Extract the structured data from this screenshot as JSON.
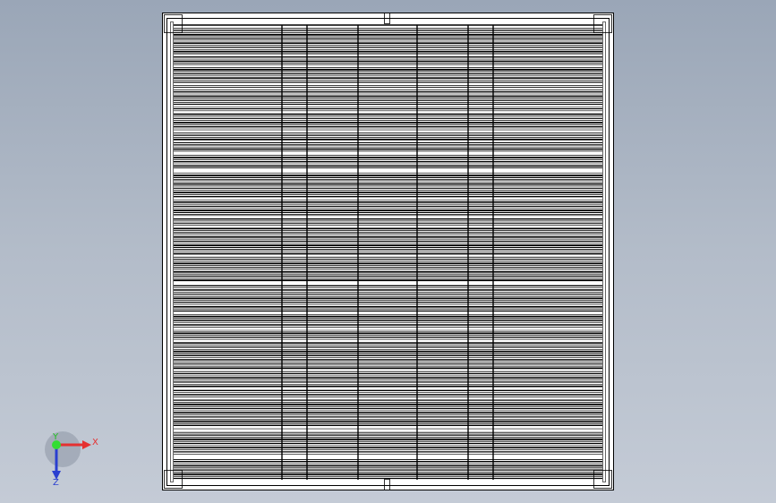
{
  "viewport": {
    "background_top": "#9aa6b7",
    "background_bottom": "#c4cbd6"
  },
  "model": {
    "part": "panel",
    "line_color": "#000000",
    "fill_color": "#ffffff",
    "orientation": "front view"
  },
  "triad": {
    "x_label": "X",
    "y_label": "Y",
    "z_label": "Z",
    "x_color": "#e53030",
    "y_color": "#22c022",
    "z_color": "#2a3fd0",
    "origin_color": "#33dd33"
  }
}
